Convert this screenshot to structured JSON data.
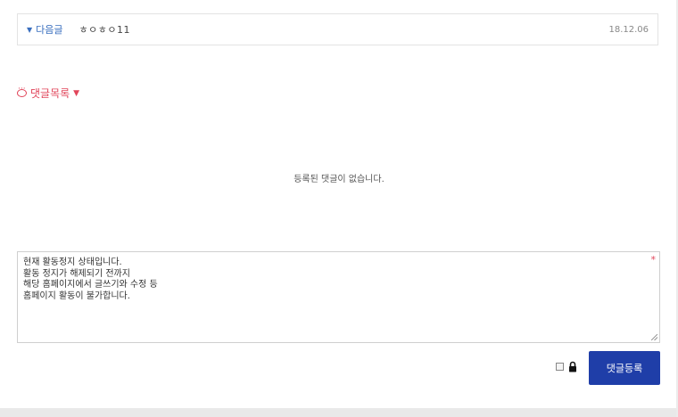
{
  "next_post": {
    "label": "다음글",
    "title": "ㅎㅇㅎㅇ11",
    "date": "18.12.06"
  },
  "comments": {
    "header": "댓글목록",
    "empty_message": "등록된 댓글이 없습니다."
  },
  "comment_form": {
    "required_mark": "*",
    "lines": [
      "현재 활동정지 상태입니다.",
      "",
      "활동 정지가 해제되기 전까지",
      "해당 홈페이지에서 글쓰기와 수정 등",
      "홈페이지 활동이 불가합니다."
    ],
    "submit_label": "댓글등록"
  },
  "colors": {
    "accent_blue": "#1f3ea8",
    "comment_red": "#e1455a",
    "link_blue": "#3a6fbf"
  }
}
